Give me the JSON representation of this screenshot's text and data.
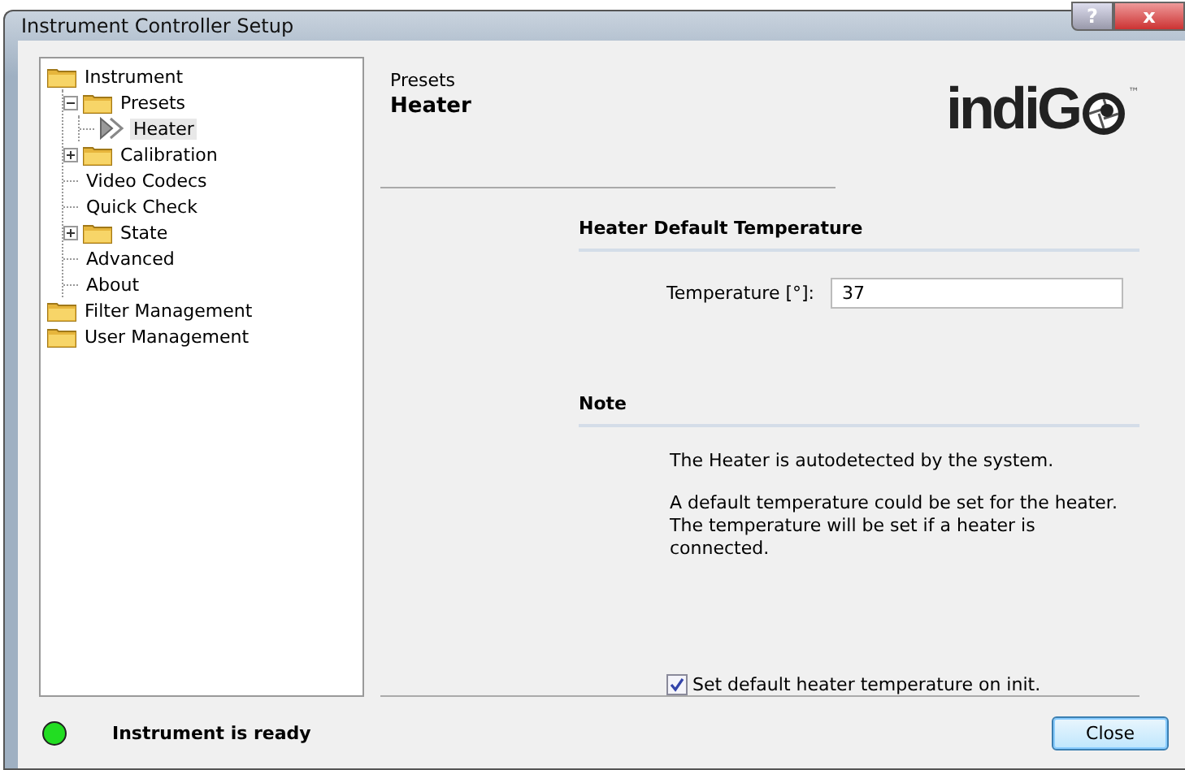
{
  "window": {
    "title": "Instrument Controller Setup",
    "help_button": "?",
    "close_button": "x"
  },
  "tree": [
    {
      "label": "Instrument",
      "kind": "folder",
      "selected": false,
      "children": [
        {
          "label": "Presets",
          "kind": "folder",
          "selected": false,
          "expanded": true,
          "children": [
            {
              "label": "Heater",
              "kind": "arrow",
              "selected": true
            }
          ]
        },
        {
          "label": "Calibration",
          "kind": "folder",
          "selected": false,
          "expanded": false
        },
        {
          "label": "Video Codecs",
          "kind": "plain",
          "selected": false
        },
        {
          "label": "Quick Check",
          "kind": "plain",
          "selected": false
        },
        {
          "label": "State",
          "kind": "folder",
          "selected": false,
          "expanded": false
        },
        {
          "label": "Advanced",
          "kind": "plain",
          "selected": false
        },
        {
          "label": "About",
          "kind": "plain",
          "selected": false
        }
      ]
    },
    {
      "label": "Filter Management",
      "kind": "folder",
      "selected": false
    },
    {
      "label": "User Management",
      "kind": "folder",
      "selected": false
    }
  ],
  "header": {
    "breadcrumb": "Presets",
    "title": "Heater",
    "logo": {
      "wordmark": "indiG",
      "trademark": "™"
    }
  },
  "sections": [
    {
      "title": "Heater Default Temperature",
      "field": {
        "label": "Temperature [°]:",
        "value": "37"
      }
    },
    {
      "title": "Note",
      "paragraphs": [
        "The Heater is autodetected by the system.",
        "A default temperature could be set for the heater. The temperature will be set if a heater is connected."
      ]
    }
  ],
  "option": {
    "label": "Set default heater temperature on init.",
    "checked": true
  },
  "status": {
    "text": "Instrument is ready",
    "color": "#22dd22"
  },
  "buttons": [
    "Close"
  ]
}
